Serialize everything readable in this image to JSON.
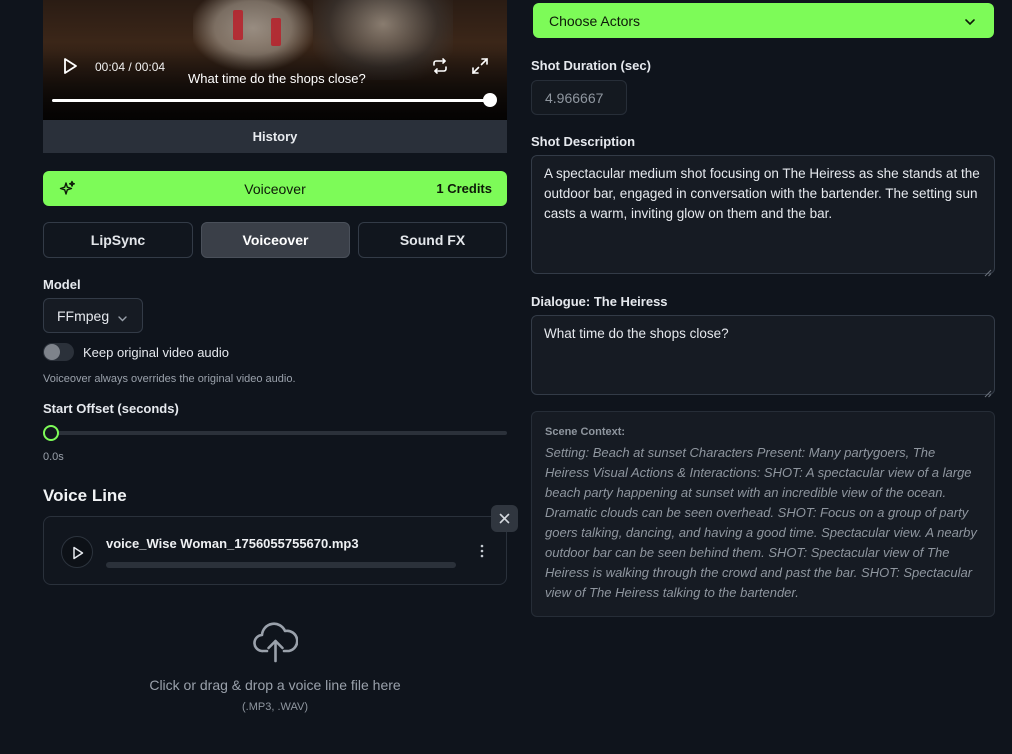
{
  "video": {
    "time": "00:04 / 00:04",
    "caption": "What time do the shops close?",
    "progress": 1.0
  },
  "tabs": {
    "history": "History"
  },
  "voiceover_bar": {
    "label": "Voiceover",
    "credits": "1 Credits"
  },
  "mode_buttons": [
    "LipSync",
    "Voiceover",
    "Sound FX"
  ],
  "active_mode": "Voiceover",
  "model": {
    "label": "Model",
    "value": "FFmpeg"
  },
  "keep_audio": {
    "label": "Keep original video audio",
    "enabled": false,
    "hint": "Voiceover always overrides the original video audio."
  },
  "start_offset": {
    "label": "Start Offset (seconds)",
    "value": "0.0s"
  },
  "voice_line": {
    "title": "Voice Line",
    "file_name": "voice_Wise Woman_1756055755670.mp3",
    "progress": 0.0
  },
  "upload": {
    "text": "Click or drag & drop a voice line file here",
    "formats": "(.MP3, .WAV)"
  },
  "actors": {
    "placeholder": "Choose Actors"
  },
  "shot_duration": {
    "label": "Shot Duration (sec)",
    "value": "4.966667"
  },
  "shot_description": {
    "label": "Shot Description",
    "text": "A spectacular medium shot focusing on The Heiress as she stands at the outdoor bar, engaged in conversation with the bartender. The setting sun casts a warm, inviting glow on them and the bar."
  },
  "dialogue": {
    "label": "Dialogue: The Heiress",
    "text": "What time do the shops close?"
  },
  "scene_context": {
    "label": "Scene Context:",
    "text": "Setting: Beach at sunset Characters Present: Many partygoers, The Heiress Visual Actions & Interactions: SHOT: A spectacular view of a large beach party happening at sunset with an incredible view of the ocean. Dramatic clouds can be seen overhead. SHOT: Focus on a group of party goers talking, dancing, and having a good time. Spectacular view. A nearby outdoor bar can be seen behind them. SHOT: Spectacular view of The Heiress is walking through the crowd and past the bar. SHOT: Spectacular view of The Heiress talking to the bartender."
  },
  "colors": {
    "accent": "#7dfb58",
    "background": "#0f141c",
    "panel": "#161b23"
  }
}
